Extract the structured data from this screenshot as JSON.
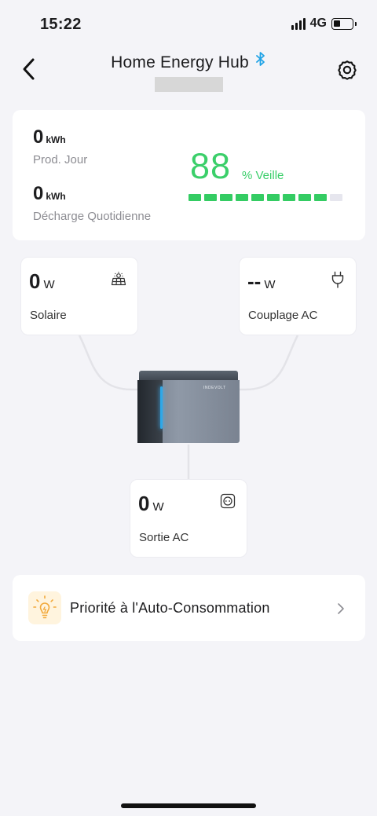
{
  "status_bar": {
    "time": "15:22",
    "network": "4G"
  },
  "header": {
    "title": "Home Energy Hub",
    "icons": {
      "back": "back-chevron-icon",
      "bluetooth": "bluetooth-icon",
      "settings": "gear-icon"
    }
  },
  "summary": {
    "daily_production_value": "0",
    "daily_production_unit": "kWh",
    "daily_production_label": "Prod. Jour",
    "daily_discharge_value": "0",
    "daily_discharge_unit": "kWh",
    "daily_discharge_label": "Décharge Quotidienne",
    "battery_level": "88",
    "battery_level_label": "% Veille",
    "battery_level_fraction": 0.88
  },
  "flow": {
    "solar": {
      "value": "0",
      "unit": "W",
      "label": "Solaire",
      "icon": "solar-panel-icon"
    },
    "ac_coupling": {
      "value": "--",
      "unit": "W",
      "label": "Couplage AC",
      "icon": "plug-icon"
    },
    "ac_output": {
      "value": "0",
      "unit": "W",
      "label": "Sortie AC",
      "icon": "outlet-icon"
    },
    "device_brand": "INDEVOLT"
  },
  "mode": {
    "label": "Priorité à l'Auto-Consommation",
    "icon": "lightbulb-icon"
  },
  "colors": {
    "accent_green": "#3bcf6a",
    "bluetooth_blue": "#1fa3e6",
    "background": "#f4f4f8"
  }
}
